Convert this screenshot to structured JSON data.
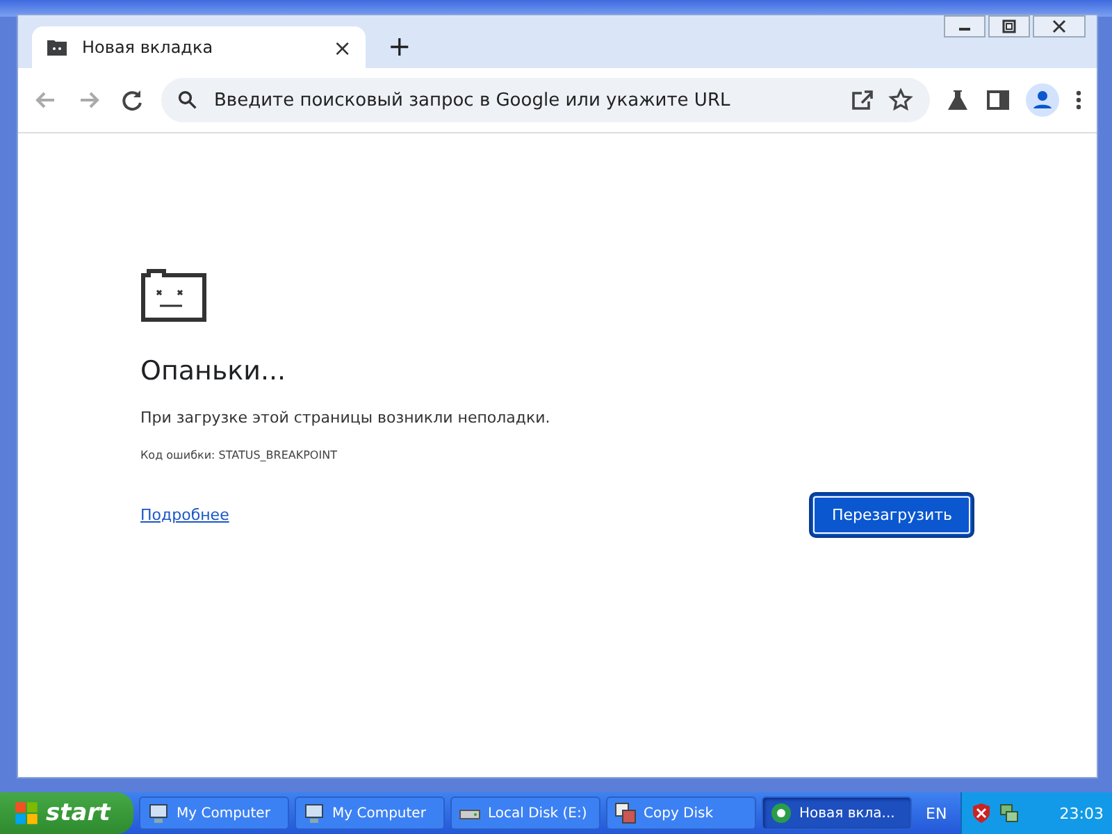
{
  "browser": {
    "tab": {
      "title": "Новая вкладка",
      "close": "×"
    },
    "new_tab": "+",
    "omnibox": {
      "placeholder": "Введите поисковый запрос в Google или укажите URL"
    }
  },
  "error_page": {
    "heading": "Опаньки...",
    "message": "При загрузке этой страницы возникли неполадки.",
    "error_code": "Код ошибки: STATUS_BREAKPOINT",
    "details_link": "Подробнее",
    "reload_button": "Перезагрузить"
  },
  "taskbar": {
    "start": "start",
    "items": [
      {
        "label": "My Computer",
        "kind": "computer",
        "selected": false
      },
      {
        "label": "My Computer",
        "kind": "computer",
        "selected": false
      },
      {
        "label": "Local Disk (E:)",
        "kind": "disk",
        "selected": false
      },
      {
        "label": "Copy Disk",
        "kind": "copy",
        "selected": false
      },
      {
        "label": "Новая вкла...",
        "kind": "browser",
        "selected": true
      }
    ],
    "language": "EN",
    "clock": "23:03"
  }
}
